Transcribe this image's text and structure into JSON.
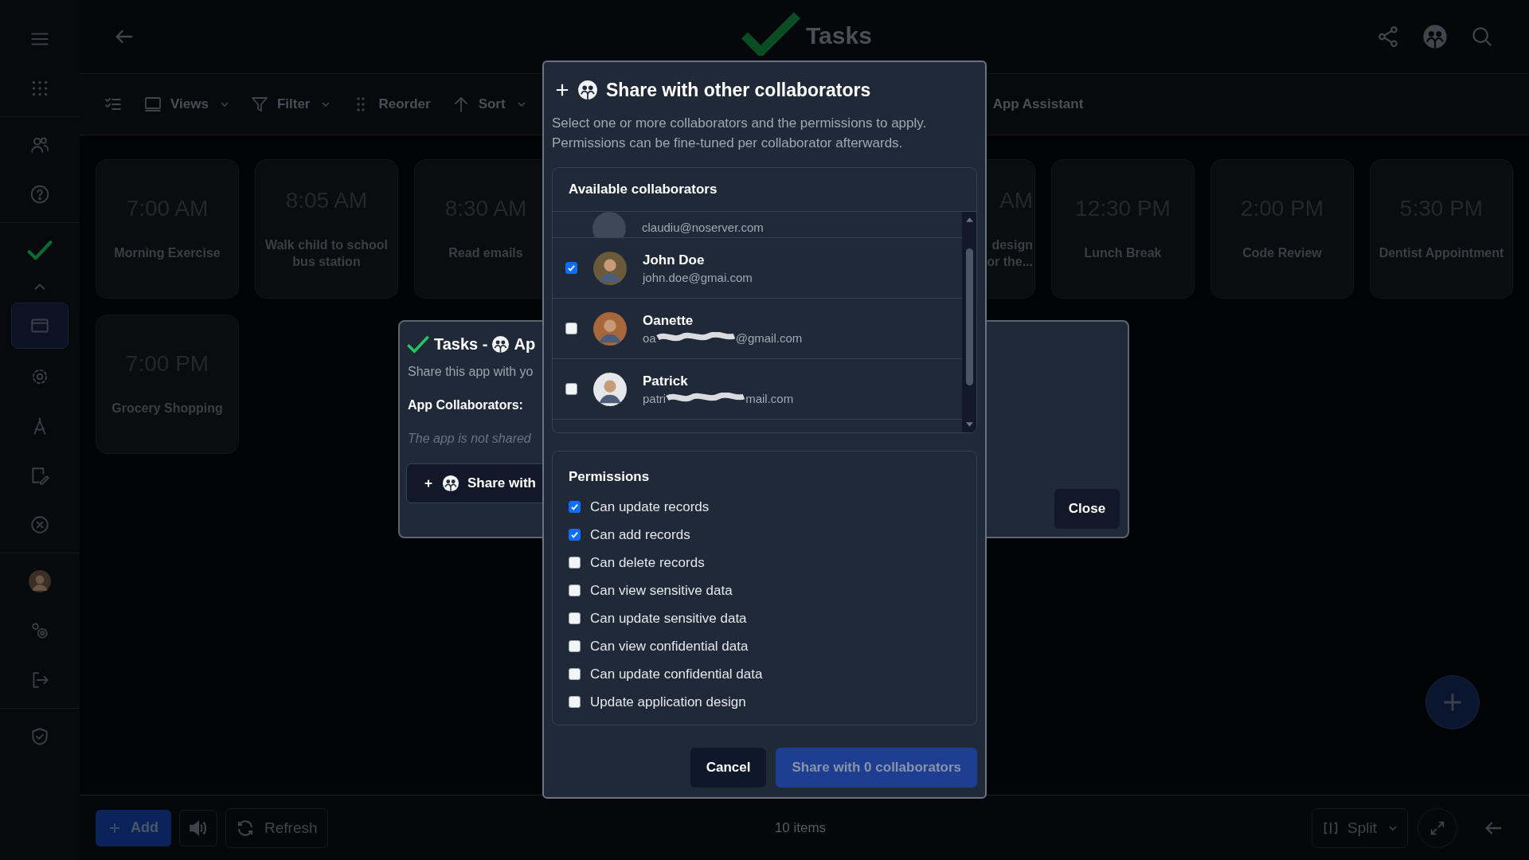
{
  "sidebar": {
    "groups": [
      [
        {
          "kind": "menu",
          "selected": false
        },
        {
          "kind": "apps",
          "selected": false
        }
      ],
      [
        {
          "kind": "users",
          "selected": false
        },
        {
          "kind": "help",
          "selected": false
        }
      ],
      [
        {
          "kind": "app",
          "selected": false
        },
        {
          "kind": "collapse",
          "selected": false
        },
        {
          "kind": "window",
          "selected": true
        },
        {
          "kind": "settings",
          "selected": false
        },
        {
          "kind": "compass",
          "selected": false
        },
        {
          "kind": "edit",
          "selected": false
        },
        {
          "kind": "close",
          "selected": false
        }
      ],
      [
        {
          "kind": "avatar",
          "selected": false
        },
        {
          "kind": "gears",
          "selected": false
        },
        {
          "kind": "logout",
          "selected": false
        }
      ],
      [
        {
          "kind": "shield",
          "selected": false
        }
      ]
    ]
  },
  "header": {
    "title": "Tasks"
  },
  "toolbar": {
    "items": [
      {
        "kind": "checklist"
      },
      {
        "kind": "views",
        "label": "Views",
        "dropdown": true
      },
      {
        "kind": "filter",
        "label": "Filter",
        "dropdown": true
      },
      {
        "kind": "reorder",
        "label": "Reorder",
        "dropdown": false
      },
      {
        "kind": "sort",
        "label": "Sort",
        "dropdown": true
      }
    ],
    "assistant_label": "App Assistant"
  },
  "card_rows": [
    [
      {
        "time": "7:00 AM",
        "title": "Morning Exercise",
        "clipped": false
      },
      {
        "time": "8:05 AM",
        "title": "Walk child to school bus station",
        "clipped": false
      },
      {
        "time": "8:30 AM",
        "title": "Read emails",
        "clipped": false
      },
      {
        "time": "AM",
        "title": "design or the...",
        "clipped": true
      },
      {
        "time": "12:30 PM",
        "title": "Lunch Break",
        "clipped": false
      },
      {
        "time": "2:00 PM",
        "title": "Code Review",
        "clipped": false
      },
      {
        "time": "5:30 PM",
        "title": "Dentist Appointment",
        "clipped": false
      }
    ],
    [
      {
        "time": "7:00 PM",
        "title": "Grocery Shopping",
        "clipped": false
      }
    ]
  ],
  "background_dialog": {
    "title_start": "Tasks -",
    "title_end": "Ap",
    "description": "Share this app with yo",
    "collaborators_heading": "App Collaborators:",
    "empty_text": "The app is not shared",
    "share_button": "Share with",
    "close_button": "Close"
  },
  "modal": {
    "title": "Share with other collaborators",
    "description": "Select one or more collaborators and the permissions to apply.\nPermissions can be fine-tuned per collaborator afterwards.",
    "collaborators_heading": "Available collaborators",
    "collaborators": [
      {
        "kind": "partial",
        "email": "claudiu@noserver.com"
      },
      {
        "kind": "full",
        "name": "John Doe",
        "email": "john.doe@gmai.com",
        "selected": true,
        "redacted": false
      },
      {
        "kind": "full",
        "name": "Oanette",
        "email": "oa",
        "email_end": "@gmail.com",
        "selected": false,
        "redacted": true
      },
      {
        "kind": "full",
        "name": "Patrick",
        "email": "patri",
        "email_end": "mail.com",
        "selected": false,
        "redacted": true
      }
    ],
    "permissions_heading": "Permissions",
    "permissions": [
      {
        "label": "Can update records",
        "checked": true
      },
      {
        "label": "Can add records",
        "checked": true
      },
      {
        "label": "Can delete records",
        "checked": false
      },
      {
        "label": "Can view sensitive data",
        "checked": false
      },
      {
        "label": "Can update sensitive data",
        "checked": false
      },
      {
        "label": "Can view confidential data",
        "checked": false
      },
      {
        "label": "Can update confidential data",
        "checked": false
      },
      {
        "label": "Update application design",
        "checked": false
      }
    ],
    "cancel_button": "Cancel",
    "share_button": {
      "label": "Share with 0 collaborators",
      "disabled": true
    }
  },
  "bottom_bar": {
    "add_button": "Add",
    "refresh_button": "Refresh",
    "item_count": "10 items",
    "split_button": "Split"
  }
}
